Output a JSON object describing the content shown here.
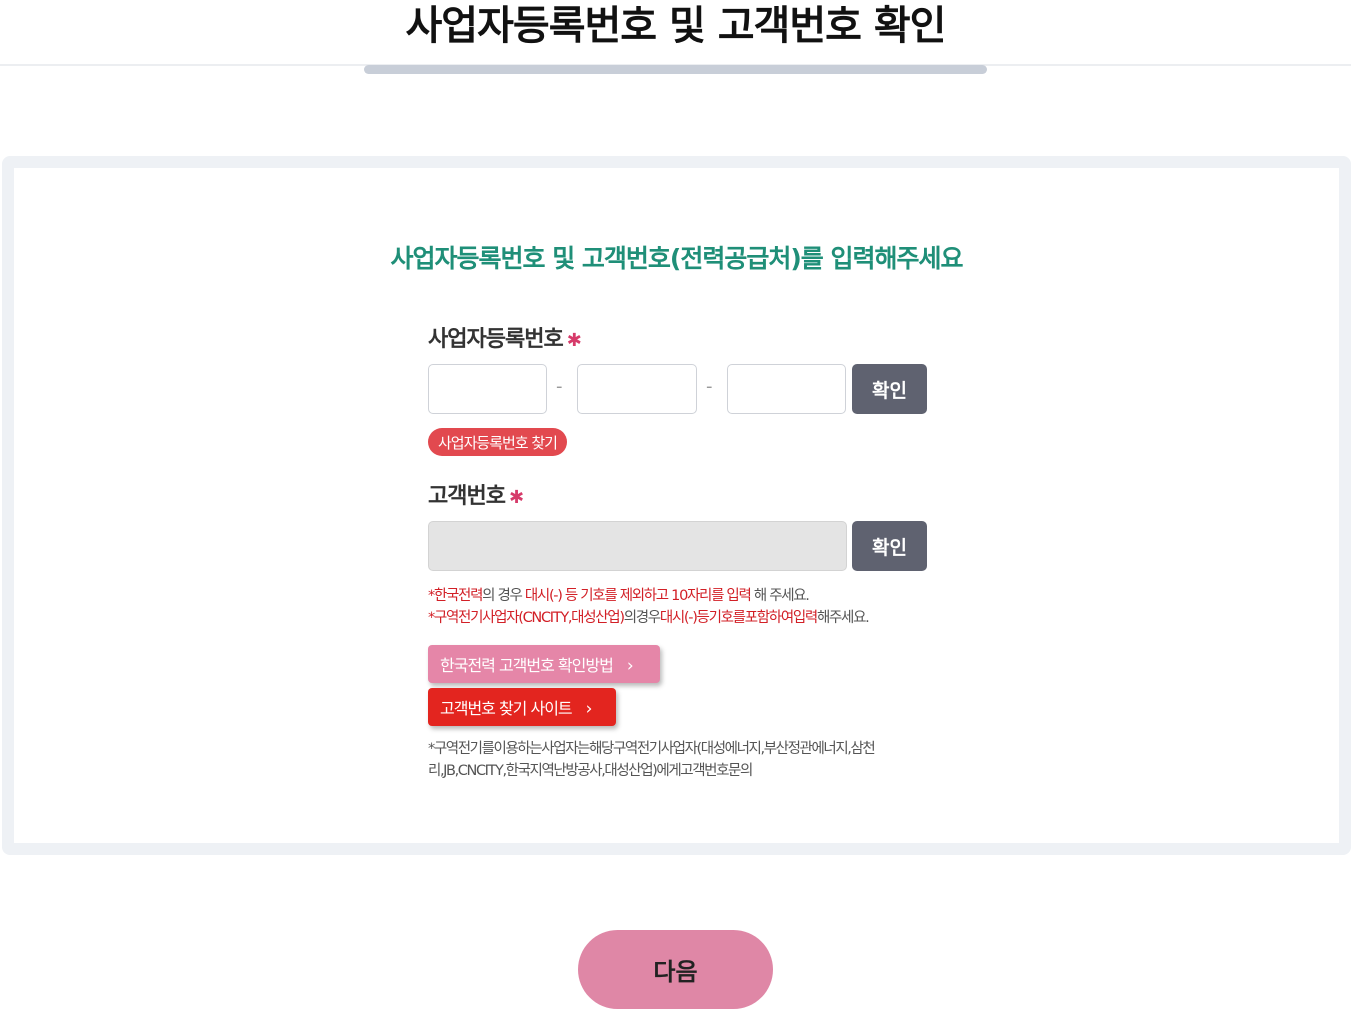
{
  "header": {
    "title": "사업자등록번호 및 고객번호 확인"
  },
  "card": {
    "heading": "사업자등록번호 및 고객번호(전력공급처)를 입력해주세요",
    "business_number": {
      "label": "사업자등록번호",
      "required_mark": "✱",
      "fields": [
        {
          "value": "",
          "placeholder": ""
        },
        {
          "value": "",
          "placeholder": ""
        },
        {
          "value": "",
          "placeholder": ""
        }
      ],
      "separator": "-",
      "confirm_label": "확인",
      "find_label": "사업자등록번호 찾기"
    },
    "customer_number": {
      "label": "고객번호",
      "required_mark": "✱",
      "value": "",
      "confirm_label": "확인"
    },
    "notes": {
      "line1": {
        "star": "*",
        "part1": "한국전력",
        "part2": "의 경우 ",
        "part3": "대시(-) 등 기호를 제외하고 10자리를 입력",
        "part4": " 해 주세요."
      },
      "line2": {
        "star": "*",
        "part1": "구역전기사업자(CNCITY,대성산업)",
        "part2": "의경우",
        "part3": "대시(-)등기호를포함하여입력",
        "part4": "해주세요."
      }
    },
    "links": {
      "kepco_method": "한국전력 고객번호 확인방법",
      "find_site": "고객번호 찾기 사이트",
      "chevron": "›"
    },
    "footnote": "*구역전기를이용하는사업자는해당구역전기사업자(대성에너지,부산정관에너지,삼천리,JB,CNCITY,한국지역난방공사,대성산업)에게고객번호문의"
  },
  "next_button": {
    "label": "다음"
  },
  "colors": {
    "heading_green": "#1f8f78",
    "required_pink": "#d63b6a",
    "note_red": "#d21f26",
    "confirm_gray": "#5f6270",
    "find_red": "#e2494f",
    "link_pink": "#e586a8",
    "link_red": "#e3251f",
    "next_pink": "#df87a6"
  }
}
